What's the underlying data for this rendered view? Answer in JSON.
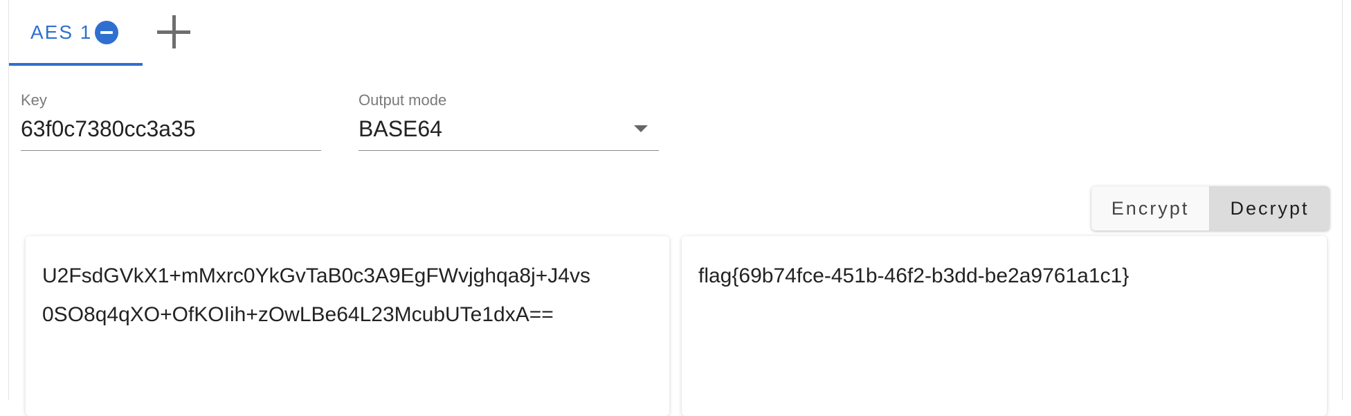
{
  "tabs": [
    {
      "label": "AES 1",
      "active": true
    }
  ],
  "fields": {
    "key": {
      "label": "Key",
      "value": "63f0c7380cc3a35"
    },
    "output_mode": {
      "label": "Output mode",
      "value": "BASE64"
    }
  },
  "actions": {
    "encrypt_label": "Encrypt",
    "decrypt_label": "Decrypt",
    "selected": "Decrypt"
  },
  "input_panel": {
    "lines": [
      "U2FsdGVkX1+mMxrc0YkGvTaB0c3A9EgFWvjghqa8j+J4vs",
      "0SO8q4qXO+OfKOIih+zOwLBe64L23McubUTe1dxA=="
    ]
  },
  "output_panel": {
    "text": "flag{69b74fce-451b-46f2-b3dd-be2a9761a1c1}"
  },
  "colors": {
    "accent": "#2f6fd0",
    "selected_button_bg": "#dcdcdc"
  },
  "icons": {
    "tab_close": "minus-circle-icon",
    "add_tab": "plus-icon",
    "dropdown": "caret-down-icon"
  }
}
